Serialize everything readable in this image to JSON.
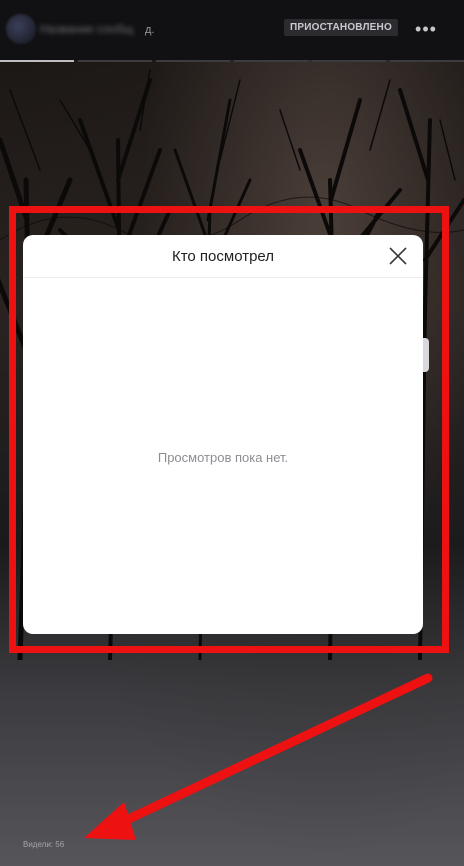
{
  "header": {
    "author_blurred": "Название сообщ",
    "author_suffix": "д.",
    "status_badge": "ПРИОСТАНОВЛЕНО",
    "more_icon": "•••"
  },
  "progress": {
    "segments": 6,
    "active_index": 0
  },
  "modal": {
    "title": "Кто посмотрел",
    "empty_state": "Просмотров пока нет.",
    "close_icon": "close-icon"
  },
  "footer": {
    "views_label": "Видели: 56"
  },
  "colors": {
    "highlight": "#ee1111",
    "modal_bg": "#ffffff",
    "page_bg": "#0b0b0c"
  }
}
